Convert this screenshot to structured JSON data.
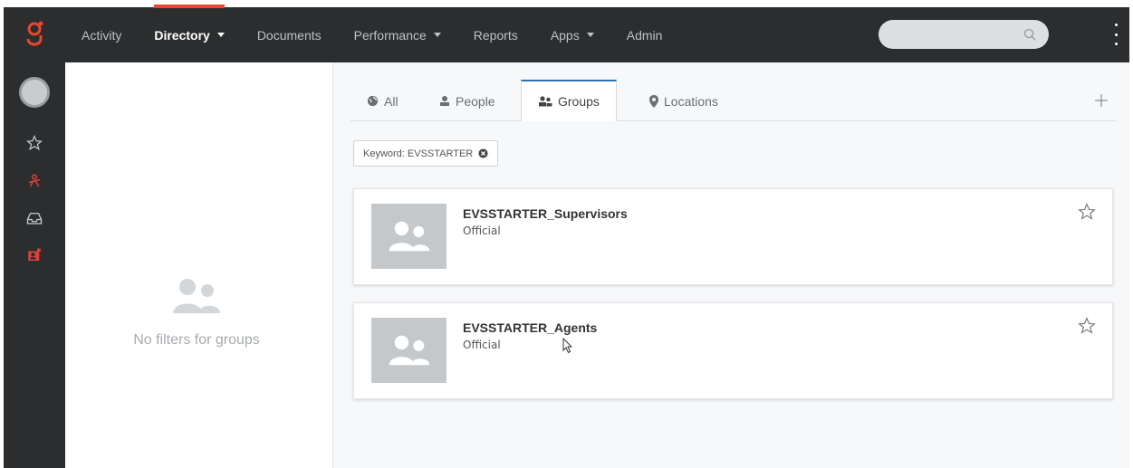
{
  "colors": {
    "topbar": "#2b2d2e",
    "accent": "#e8462f",
    "tab_accent": "#2f6fb3",
    "rail_red": "#d9443a"
  },
  "nav": {
    "items": [
      {
        "label": "Activity",
        "dropdown": false,
        "active": false
      },
      {
        "label": "Directory",
        "dropdown": true,
        "active": true
      },
      {
        "label": "Documents",
        "dropdown": false,
        "active": false
      },
      {
        "label": "Performance",
        "dropdown": true,
        "active": false
      },
      {
        "label": "Reports",
        "dropdown": false,
        "active": false
      },
      {
        "label": "Apps",
        "dropdown": true,
        "active": false
      },
      {
        "label": "Admin",
        "dropdown": false,
        "active": false
      }
    ],
    "search_placeholder": "",
    "icons": [
      "genesys-logo-icon",
      "search-icon",
      "more-vertical-icon"
    ]
  },
  "rail": {
    "icons": [
      "avatar",
      "star-icon",
      "directory-icon",
      "inbox-icon",
      "contact-card-icon"
    ]
  },
  "filter_panel": {
    "empty_message": "No filters for groups",
    "icon": "groups-icon"
  },
  "tabs": [
    {
      "label": "All",
      "icon": "globe-icon",
      "active": false
    },
    {
      "label": "People",
      "icon": "person-icon",
      "active": false
    },
    {
      "label": "Groups",
      "icon": "groups-icon",
      "active": true
    },
    {
      "label": "Locations",
      "icon": "map-marker-icon",
      "active": false
    }
  ],
  "keyword_chip": {
    "label": "Keyword: EVSSTARTER"
  },
  "results": [
    {
      "title": "EVSSTARTER_Supervisors",
      "subtitle": "Official"
    },
    {
      "title": "EVSSTARTER_Agents",
      "subtitle": "Official"
    }
  ]
}
